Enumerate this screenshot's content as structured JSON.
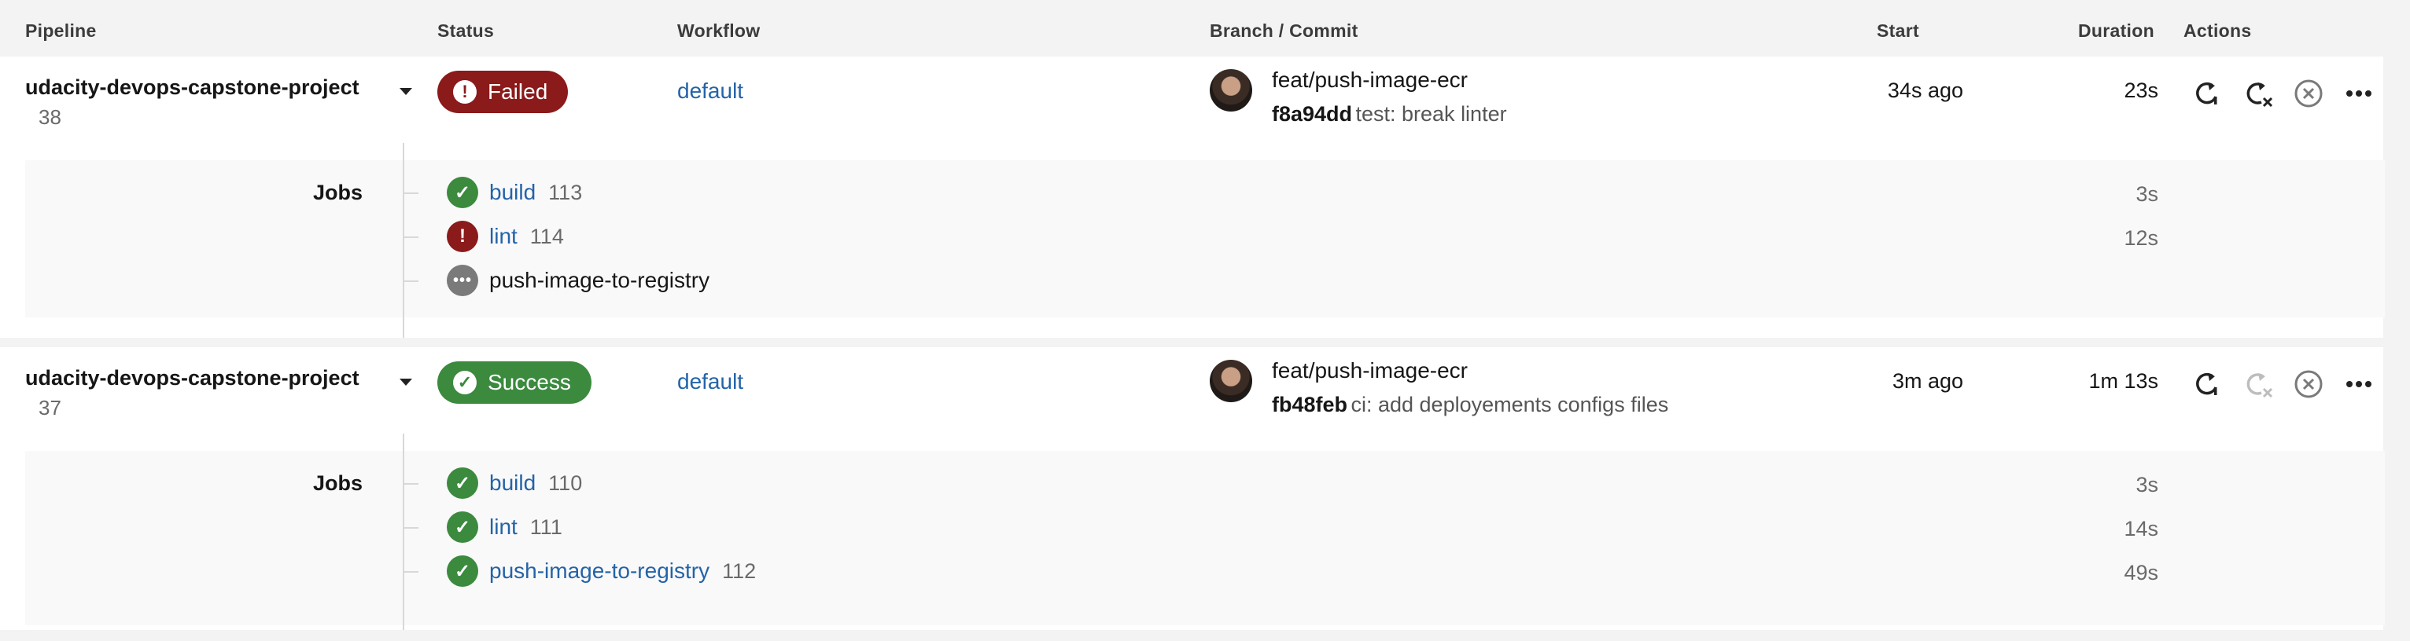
{
  "headers": {
    "pipeline": "Pipeline",
    "status": "Status",
    "workflow": "Workflow",
    "branch_commit": "Branch / Commit",
    "start": "Start",
    "duration": "Duration",
    "actions": "Actions"
  },
  "jobs_label": "Jobs",
  "pipelines": [
    {
      "project": "udacity-devops-capstone-project",
      "number": "38",
      "status": "Failed",
      "status_icon": "exclamation-icon",
      "workflow": "default",
      "branch": "feat/push-image-ecr",
      "commit_sha": "f8a94dd",
      "commit_message": "test: break linter",
      "start": "34s ago",
      "duration": "23s",
      "jobs": [
        {
          "name": "build",
          "number": "113",
          "status": "success",
          "duration": "3s"
        },
        {
          "name": "lint",
          "number": "114",
          "status": "failed",
          "duration": "12s"
        },
        {
          "name": "push-image-to-registry",
          "number": "",
          "status": "blocked",
          "duration": ""
        }
      ]
    },
    {
      "project": "udacity-devops-capstone-project",
      "number": "37",
      "status": "Success",
      "status_icon": "check-icon",
      "workflow": "default",
      "branch": "feat/push-image-ecr",
      "commit_sha": "fb48feb",
      "commit_message": "ci: add deployements configs files",
      "start": "3m ago",
      "duration": "1m 13s",
      "jobs": [
        {
          "name": "build",
          "number": "110",
          "status": "success",
          "duration": "3s"
        },
        {
          "name": "lint",
          "number": "111",
          "status": "success",
          "duration": "14s"
        },
        {
          "name": "push-image-to-registry",
          "number": "112",
          "status": "success",
          "duration": "49s"
        }
      ]
    }
  ],
  "colors": {
    "failed": "#8b1a1a",
    "success": "#3b8a3e",
    "blocked": "#7a7a7a",
    "link": "#2463a8"
  }
}
